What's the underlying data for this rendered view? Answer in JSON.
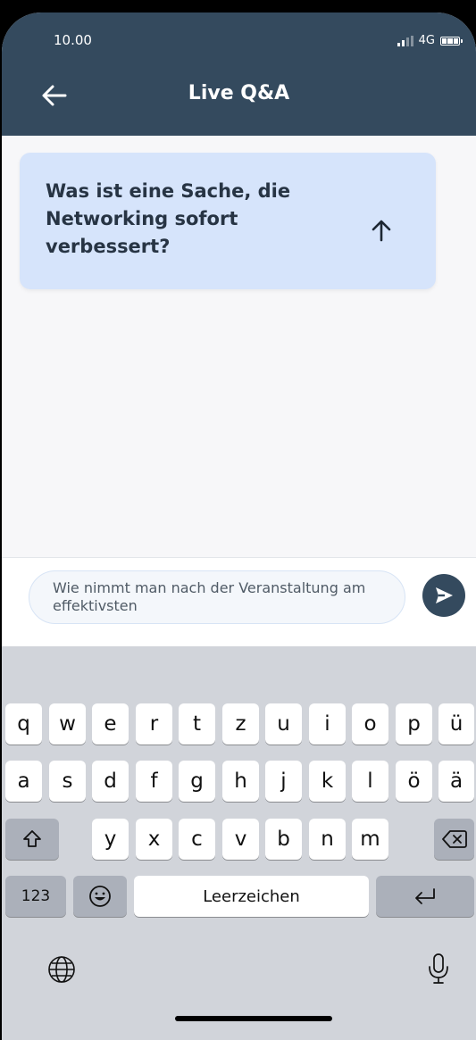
{
  "status_bar": {
    "time": "10.00",
    "network": "4G"
  },
  "header": {
    "title": "Live Q&A",
    "back_icon": "arrow-left-icon"
  },
  "questions": [
    {
      "text": "Was ist eine Sache, die Networking sofort verbessert?",
      "upvote_icon": "arrow-up-icon"
    }
  ],
  "composer": {
    "value": "Wie nimmt man nach der Veranstaltung am effektivsten",
    "send_icon": "send-icon"
  },
  "keyboard": {
    "row1": [
      "q",
      "w",
      "e",
      "r",
      "t",
      "z",
      "u",
      "i",
      "o",
      "p",
      "ü"
    ],
    "row2": [
      "a",
      "s",
      "d",
      "f",
      "g",
      "h",
      "j",
      "k",
      "l",
      "ö",
      "ä"
    ],
    "row3": [
      "y",
      "x",
      "c",
      "v",
      "b",
      "n",
      "m"
    ],
    "numbers_key": "123",
    "space_label": "Leerzeichen",
    "icons": [
      "shift-icon",
      "backspace-icon",
      "emoji-icon",
      "return-icon",
      "globe-icon",
      "microphone-icon"
    ]
  },
  "colors": {
    "header": "#344a5e",
    "card": "#d6e4fb",
    "keyboard": "#d1d4da"
  }
}
